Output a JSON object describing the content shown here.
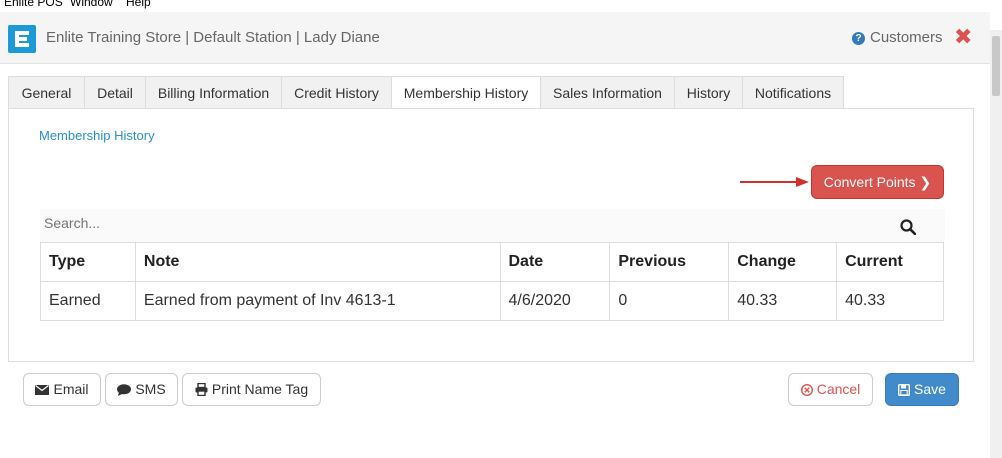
{
  "menubar": [
    "Enlite POS",
    "Window",
    "Help"
  ],
  "app": {
    "title": "Enlite Training Store | Default Station | Lady Diane",
    "help_label": "Customers",
    "help_icon": "question-circle-icon",
    "close_icon": "close-icon",
    "accent": "#1b9ad6"
  },
  "tabs": [
    {
      "label": "General",
      "active": false
    },
    {
      "label": "Detail",
      "active": false
    },
    {
      "label": "Billing Information",
      "active": false
    },
    {
      "label": "Credit History",
      "active": false
    },
    {
      "label": "Membership History",
      "active": true
    },
    {
      "label": "Sales Information",
      "active": false
    },
    {
      "label": "History",
      "active": false
    },
    {
      "label": "Notifications",
      "active": false
    }
  ],
  "membership": {
    "section_title": "Membership History",
    "convert_label": "Convert Points",
    "convert_color": "#d9534f",
    "search_placeholder": "Search...",
    "columns": [
      "Type",
      "Note",
      "Date",
      "Previous",
      "Change",
      "Current"
    ],
    "rows": [
      [
        "Earned",
        "Earned from payment of Inv 4613-1",
        "4/6/2020",
        "0",
        "40.33",
        "40.33"
      ]
    ]
  },
  "footer": {
    "email_label": "Email",
    "sms_label": "SMS",
    "print_label": "Print Name Tag",
    "cancel_label": "Cancel",
    "save_label": "Save",
    "save_color": "#428bca"
  }
}
